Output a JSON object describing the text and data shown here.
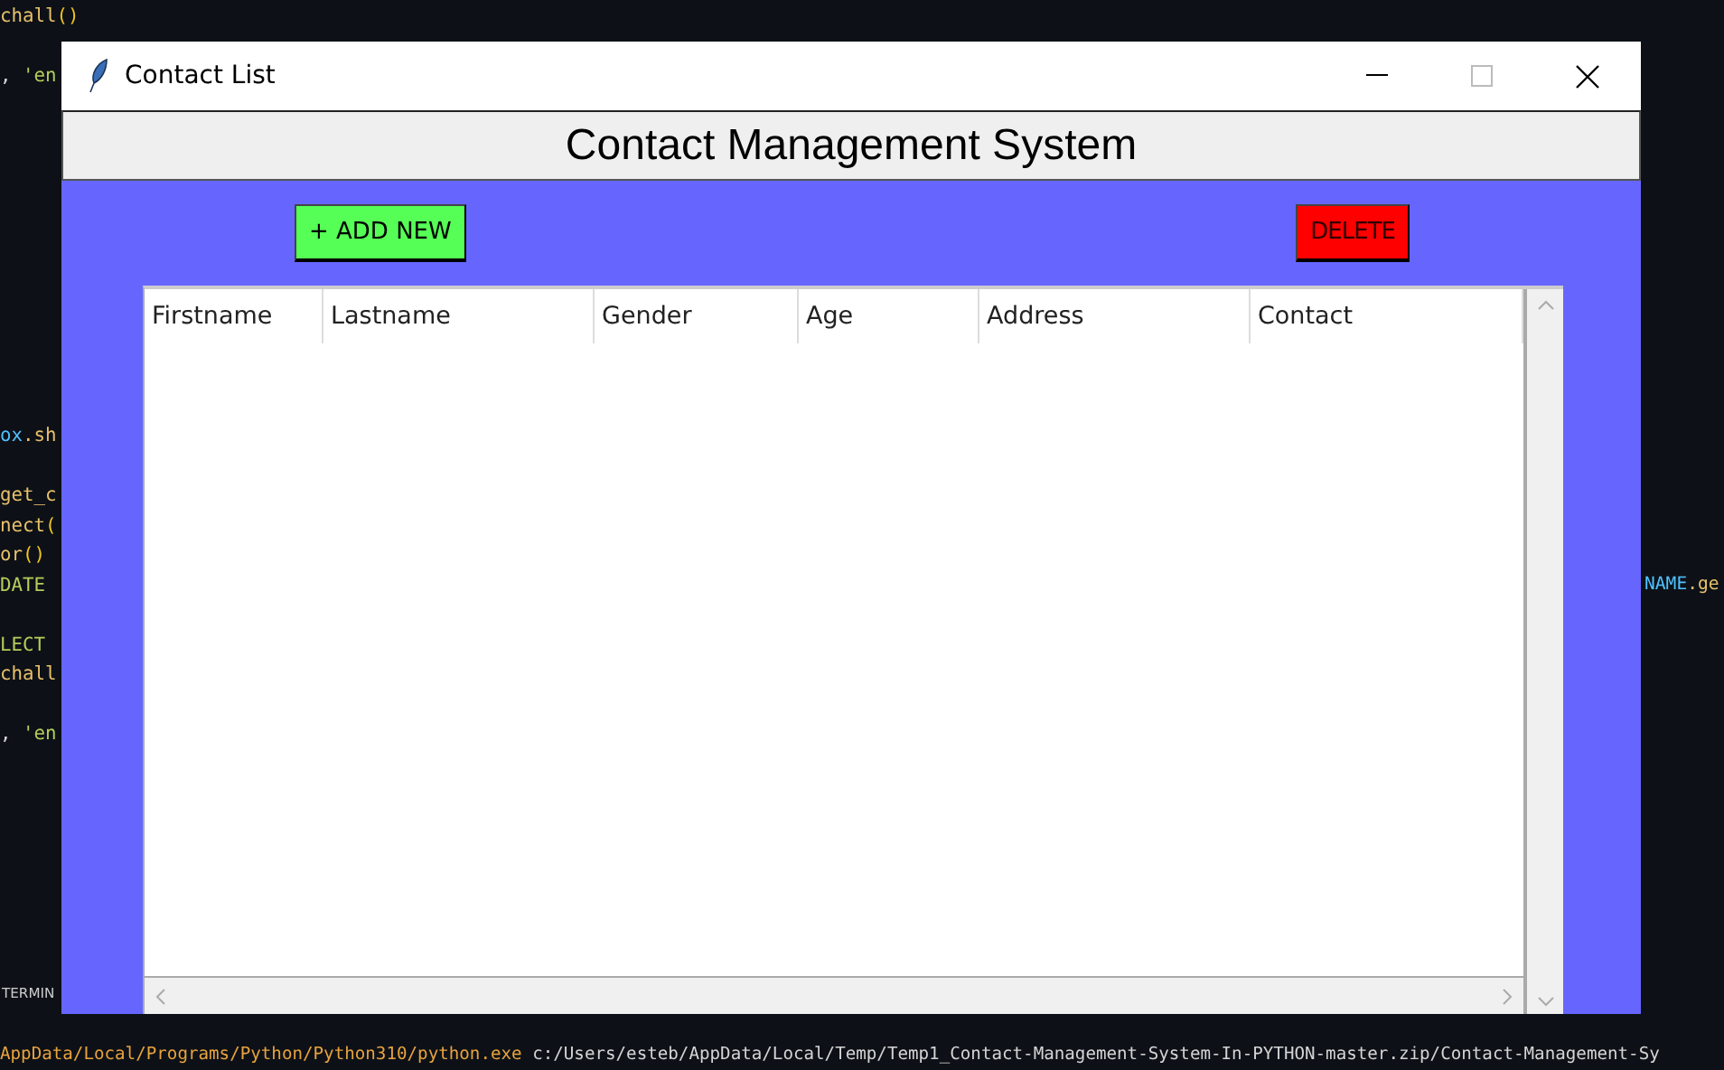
{
  "editor": {
    "code_lines": [
      {
        "segments": [
          {
            "text": "chall",
            "kind": "fn"
          },
          {
            "text": "()",
            "kind": "paren"
          }
        ]
      },
      {
        "segments": [
          {
            "text": ", ",
            "kind": "plain"
          },
          {
            "text": "'en",
            "kind": "str"
          }
        ]
      },
      {
        "segments": [
          {
            "text": "ox",
            "kind": "var"
          },
          {
            "text": ".sh",
            "kind": "fn"
          }
        ]
      },
      {
        "segments": [
          {
            "text": "get_c",
            "kind": "fn"
          }
        ]
      },
      {
        "segments": [
          {
            "text": "nect",
            "kind": "fn"
          },
          {
            "text": "(",
            "kind": "paren"
          }
        ]
      },
      {
        "segments": [
          {
            "text": "or",
            "kind": "fn"
          },
          {
            "text": "()",
            "kind": "paren"
          }
        ]
      },
      {
        "segments": [
          {
            "text": "DATE",
            "kind": "str"
          }
        ]
      },
      {
        "segments": [
          {
            "text": "LECT",
            "kind": "str"
          }
        ]
      },
      {
        "segments": [
          {
            "text": "chall",
            "kind": "fn"
          }
        ]
      },
      {
        "segments": [
          {
            "text": ", ",
            "kind": "plain"
          },
          {
            "text": "'en",
            "kind": "str"
          }
        ]
      }
    ],
    "right_fragment": [
      {
        "text": "NAME",
        "kind": "var"
      },
      {
        "text": ".ge",
        "kind": "fn"
      }
    ],
    "panel_tab": "TERMIN",
    "terminal_line": [
      {
        "text": "AppData/Local/Programs/Python/Python310/python.exe",
        "kind": "fn"
      },
      {
        "text": " c:/Users/esteb/AppData/Local/Temp/Temp1_Contact-Management-System-In-PYTHON-master.zip/Contact-Management-Sy",
        "kind": "plain"
      }
    ]
  },
  "window": {
    "title": "Contact List",
    "heading": "Contact Management System",
    "buttons": [
      {
        "label": "+ ADD NEW",
        "kind": "add"
      },
      {
        "label": "DELETE",
        "kind": "delete"
      }
    ],
    "table": {
      "columns": [
        "Firstname",
        "Lastname",
        "Gender",
        "Age",
        "Address",
        "Contact"
      ]
    }
  }
}
